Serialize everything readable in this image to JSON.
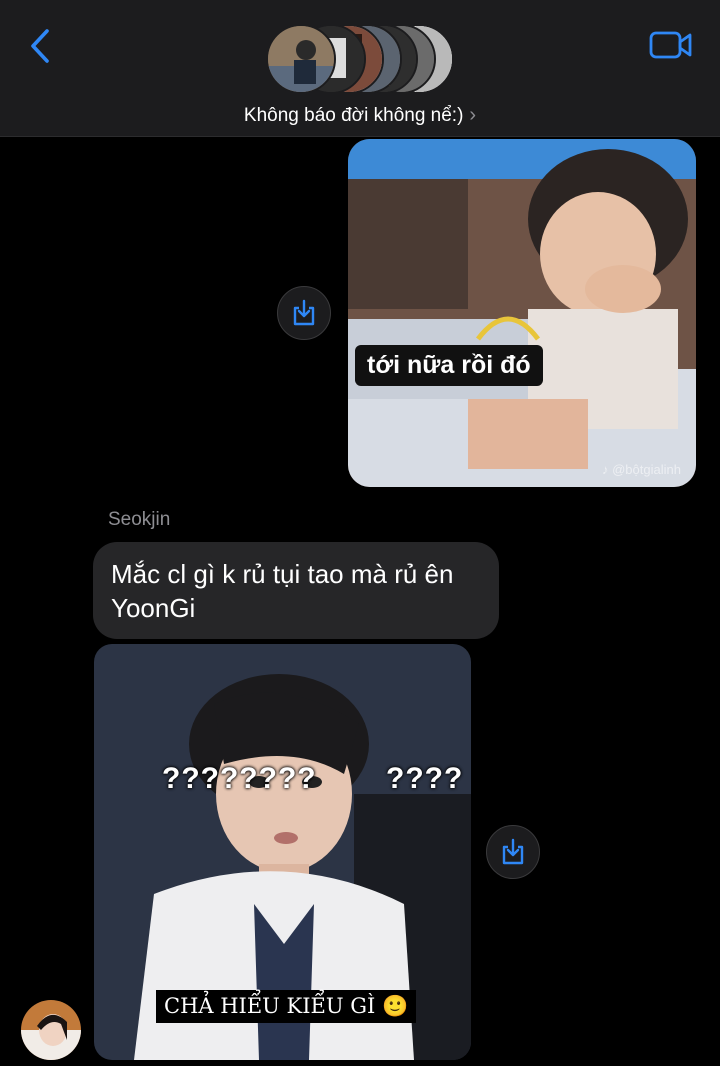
{
  "header": {
    "back_icon": "chevron-left-icon",
    "video_icon": "video-camera-icon",
    "group_title": "Không báo đời không nể:)",
    "title_chevron": "›",
    "accent_color": "#2f87f5"
  },
  "messages": {
    "outgoing_image": {
      "caption": "tới nữa rồi đó",
      "watermark": "♪ @bộtgialinh"
    },
    "sender_name": "Seokjin",
    "incoming_text": "Mắc cl gì k rủ tụi tao mà rủ ên YoonGi",
    "incoming_image": {
      "top_text_left": "????????",
      "top_text_right": "????",
      "caption": "CHẢ HIỂU KIỂU GÌ 🙂"
    },
    "save_icon": "save-download-icon"
  }
}
